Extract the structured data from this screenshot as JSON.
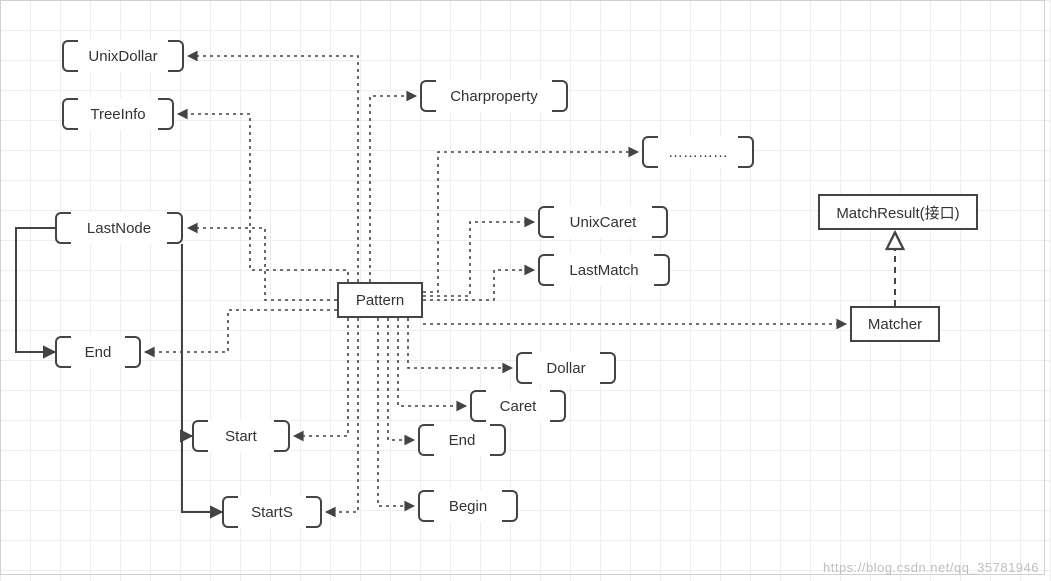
{
  "nodes": {
    "unixDollar": {
      "label": "UnixDollar"
    },
    "treeInfo": {
      "label": "TreeInfo"
    },
    "lastNode": {
      "label": "LastNode"
    },
    "end": {
      "label": "End"
    },
    "start": {
      "label": "Start"
    },
    "startS": {
      "label": "StartS"
    },
    "pattern": {
      "label": "Pattern"
    },
    "charProperty": {
      "label": "Charproperty"
    },
    "ellipsis": {
      "label": "…………"
    },
    "unixCaret": {
      "label": "UnixCaret"
    },
    "lastMatch": {
      "label": "LastMatch"
    },
    "dollar": {
      "label": "Dollar"
    },
    "caret": {
      "label": "Caret"
    },
    "end2": {
      "label": "End"
    },
    "begin": {
      "label": "Begin"
    },
    "matcher": {
      "label": "Matcher"
    },
    "matchResult": {
      "label": "MatchResult(接口)"
    }
  },
  "watermark": "https://blog.csdn.net/qq_35781946"
}
